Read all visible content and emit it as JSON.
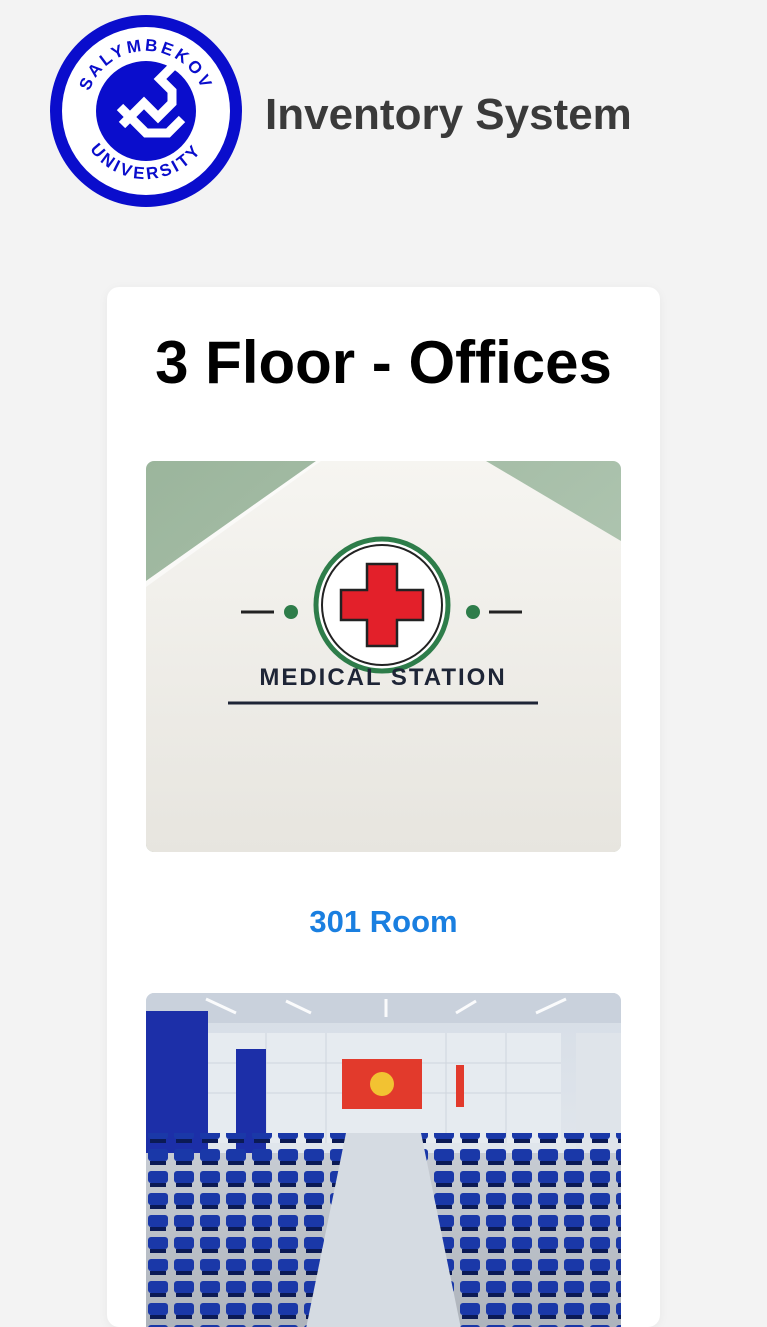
{
  "header": {
    "logo_top_text": "SALYMBEKOV",
    "logo_bottom_text": "UNIVERSITY",
    "title": "Inventory System"
  },
  "floor": {
    "title": "3 Floor - Offices"
  },
  "rooms": [
    {
      "image_sign_text": "MEDICAL STATION",
      "label": "301 Room"
    },
    {
      "image_sign_text": "",
      "label": ""
    }
  ],
  "colors": {
    "background": "#f3f3f3",
    "card": "#ffffff",
    "link": "#1a7fe0",
    "logo_blue": "#0a0dcc",
    "title_text": "#3a3a3a"
  }
}
